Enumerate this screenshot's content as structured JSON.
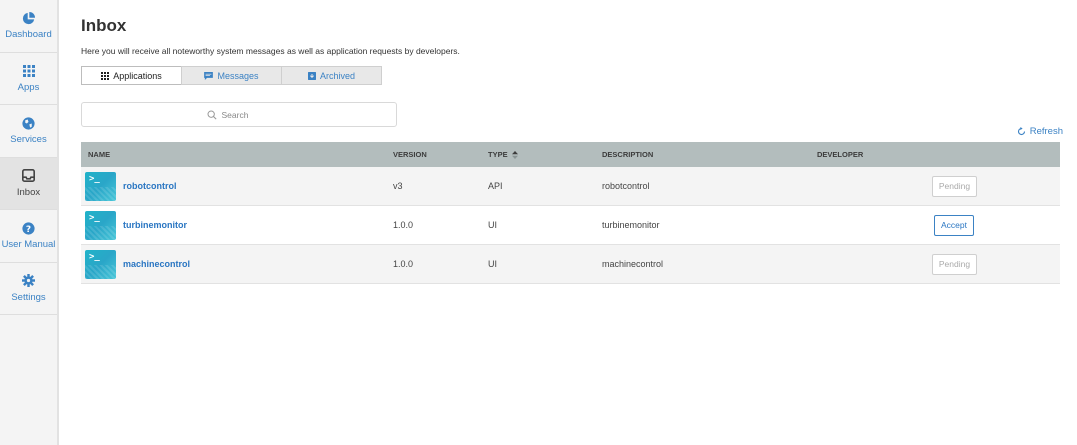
{
  "sidebar": {
    "items": [
      {
        "label": "Dashboard",
        "icon": "pie-chart-icon"
      },
      {
        "label": "Apps",
        "icon": "grid-icon"
      },
      {
        "label": "Services",
        "icon": "globe-icon"
      },
      {
        "label": "Inbox",
        "icon": "inbox-icon",
        "active": true
      },
      {
        "label": "User Manual",
        "icon": "question-icon"
      },
      {
        "label": "Settings",
        "icon": "gear-icon"
      }
    ]
  },
  "header": {
    "title": "Inbox",
    "description": "Here you will receive all noteworthy system messages as well as application requests by developers."
  },
  "tabs": [
    {
      "label": "Applications",
      "icon": "grid-icon",
      "active": true
    },
    {
      "label": "Messages",
      "icon": "message-icon"
    },
    {
      "label": "Archived",
      "icon": "archive-icon"
    }
  ],
  "search": {
    "placeholder": "Search"
  },
  "refresh_label": "Refresh",
  "table": {
    "columns": [
      "NAME",
      "VERSION",
      "TYPE",
      "DESCRIPTION",
      "DEVELOPER"
    ],
    "rows": [
      {
        "name": "robotcontrol",
        "version": "v3",
        "type": "API",
        "description": "robotcontrol",
        "developer": "",
        "action": "Pending"
      },
      {
        "name": "turbinemonitor",
        "version": "1.0.0",
        "type": "UI",
        "description": "turbinemonitor",
        "developer": "",
        "action": "Accept"
      },
      {
        "name": "machinecontrol",
        "version": "1.0.0",
        "type": "UI",
        "description": "machinecontrol",
        "developer": "",
        "action": "Pending"
      }
    ]
  },
  "colors": {
    "accent": "#3b82c4",
    "table_header": "#b3bdbd",
    "app_icon": "#20b3c9"
  }
}
